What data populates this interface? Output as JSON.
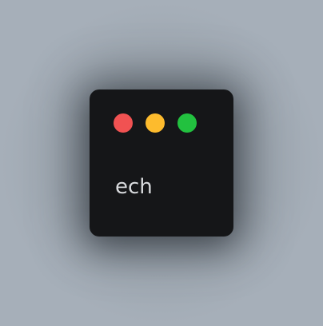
{
  "window": {
    "controls": [
      {
        "name": "close",
        "color": "#f15252"
      },
      {
        "name": "minimize",
        "color": "#fdbb2d"
      },
      {
        "name": "maximize",
        "color": "#22c13f"
      }
    ],
    "text": "ech"
  },
  "colors": {
    "window_background": "#151618",
    "text": "#d8dadd",
    "page_background": "#a6afb9"
  }
}
